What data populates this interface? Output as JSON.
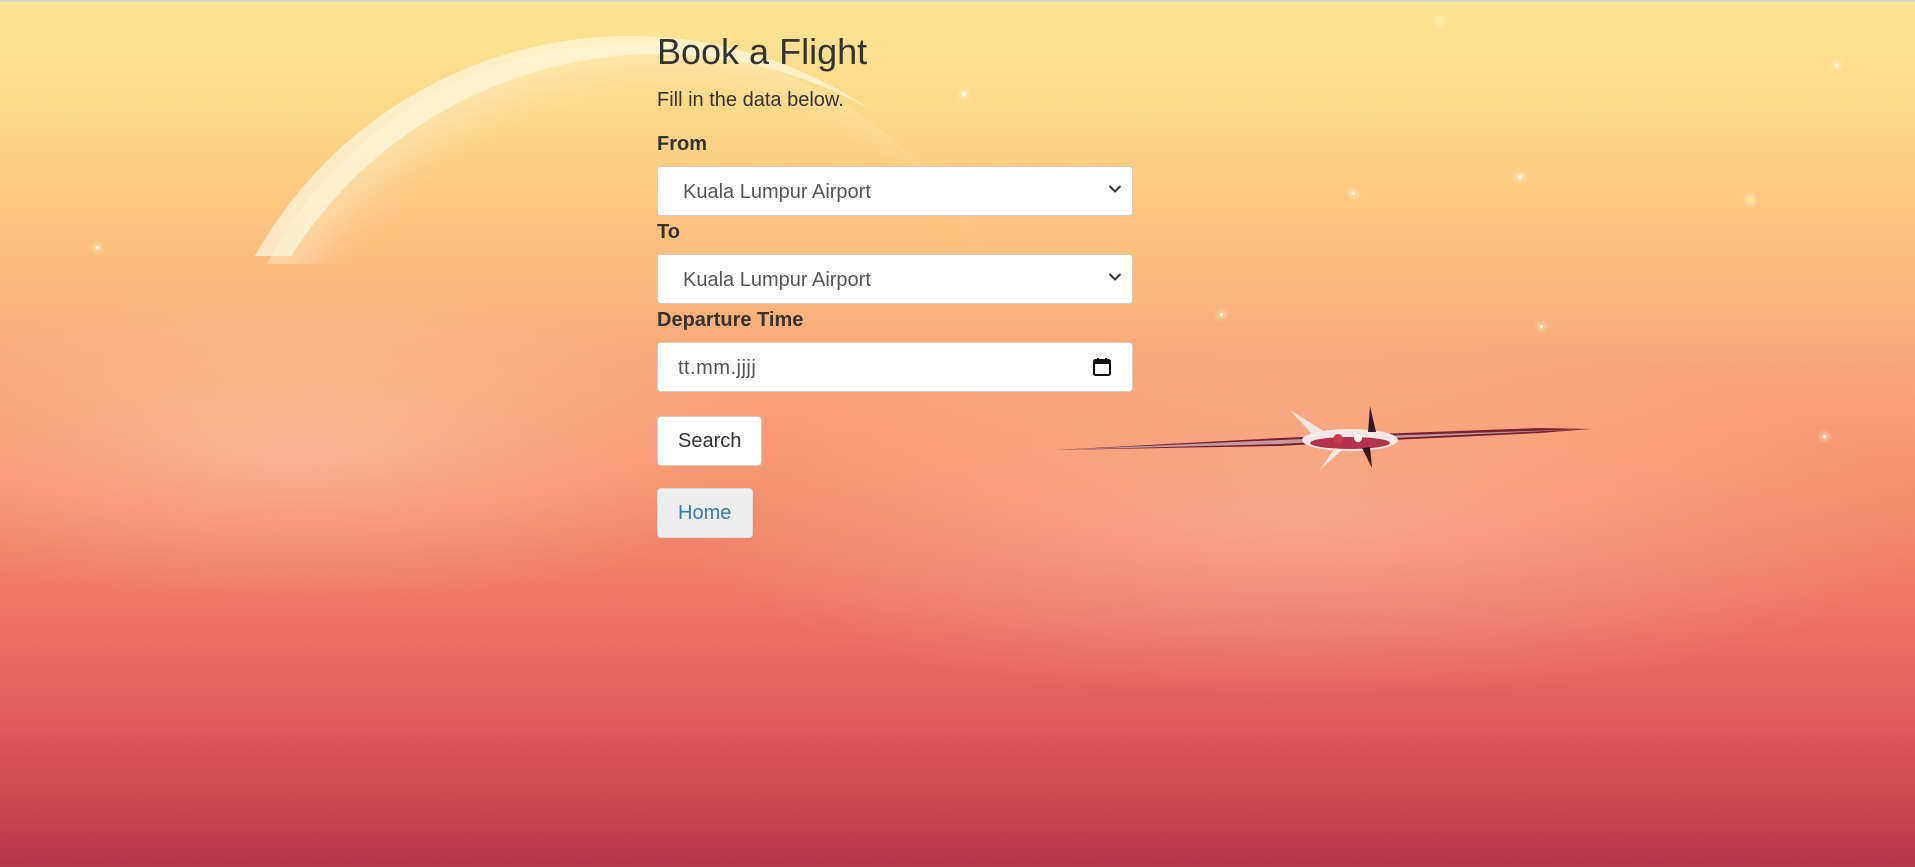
{
  "page": {
    "title": "Book a Flight",
    "subtitle": "Fill in the data below."
  },
  "form": {
    "from": {
      "label": "From",
      "selected": "Kuala Lumpur Airport"
    },
    "to": {
      "label": "To",
      "selected": "Kuala Lumpur Airport"
    },
    "departure": {
      "label": "Departure Time",
      "placeholder": "tt.mm.jjjj"
    },
    "search_button": "Search"
  },
  "nav": {
    "home_button": "Home"
  },
  "icons": {
    "select_arrow": "chevron-down-icon",
    "date_picker": "calendar-icon"
  },
  "colors": {
    "link": "#337ab7",
    "text": "#333333"
  }
}
